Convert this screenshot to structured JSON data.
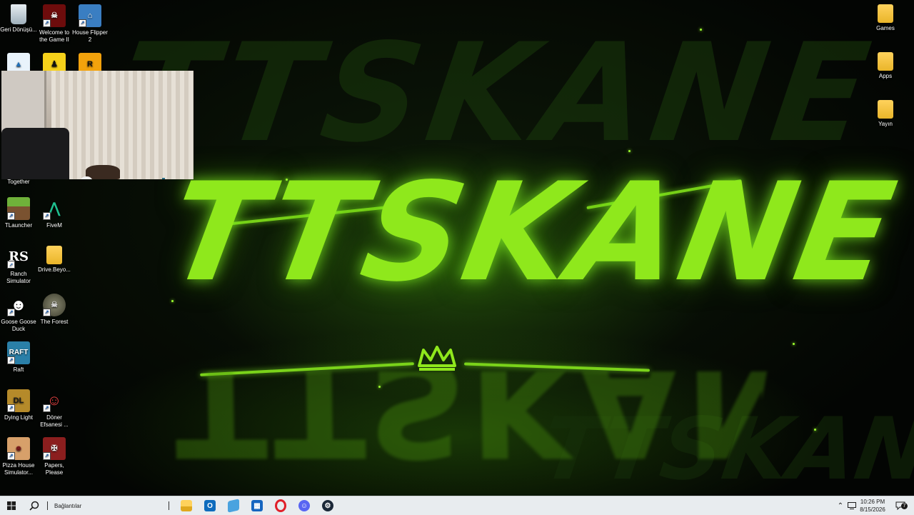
{
  "wallpaper": {
    "brand": "TTSKANE",
    "accent_color": "#8fe81c"
  },
  "desktop_icons_left": [
    {
      "label": "Geri Dönüşü...",
      "icon": "recycle-bin-icon",
      "color": "#c9d3da"
    },
    {
      "label": "Welcome to the Game II",
      "icon": "skull-game-icon",
      "color": "#8a1010"
    },
    {
      "label": "House Flipper 2",
      "icon": "house-flipper-icon",
      "color": "#3a7ec2"
    },
    {
      "label": "Together",
      "icon": "together-game-icon",
      "color": "#333333"
    },
    {
      "label": "TLauncher",
      "icon": "tlauncher-icon",
      "color": "#5a8f2a"
    },
    {
      "label": "FiveM",
      "icon": "fivem-icon",
      "color": "#1d1d1d"
    },
    {
      "label": "Ranch Simulator",
      "icon": "ranch-simulator-icon",
      "color": "#f2f2f2"
    },
    {
      "label": "Drive.Beyo...",
      "icon": "folder-icon",
      "color": "#ffd25c"
    },
    {
      "label": "Goose Goose Duck",
      "icon": "goose-goose-duck-icon",
      "color": "#f5f5f5"
    },
    {
      "label": "The Forest",
      "icon": "the-forest-icon",
      "color": "#4b4b3a"
    },
    {
      "label": "Raft",
      "icon": "raft-icon",
      "color": "#2a7fa8"
    },
    {
      "label": "Dying Light",
      "icon": "dying-light-icon",
      "color": "#7a5a1a"
    },
    {
      "label": "Döner Efsanesi ...",
      "icon": "doner-efsanesi-icon",
      "color": "#b8282a"
    },
    {
      "label": "Pizza House Simulator...",
      "icon": "pizza-house-icon",
      "color": "#d7a06a"
    },
    {
      "label": "Papers, Please",
      "icon": "papers-please-icon",
      "color": "#8b1e1e"
    }
  ],
  "desktop_icons_right": [
    {
      "label": "Games",
      "icon": "folder-icon"
    },
    {
      "label": "Apps",
      "icon": "folder-icon"
    },
    {
      "label": "Yayın",
      "icon": "folder-icon"
    }
  ],
  "taskbar": {
    "search_label": "Bağlantılar",
    "time": "10:26 PM",
    "date": "8/15/2026",
    "notification_count": "7",
    "background": "#e8ecef"
  }
}
